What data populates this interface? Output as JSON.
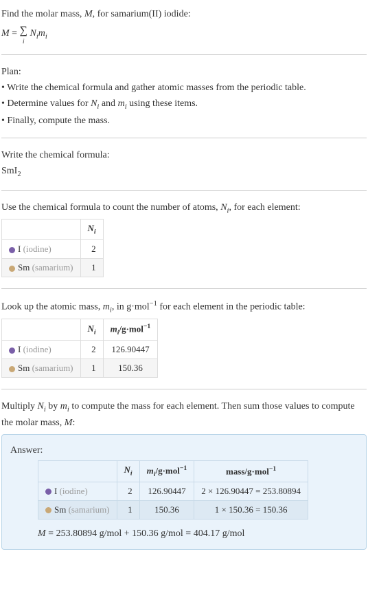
{
  "intro": {
    "line1_prefix": "Find the molar mass, ",
    "line1_var": "M",
    "line1_suffix": ", for samarium(II) iodide:",
    "formula_lhs": "M",
    "formula_eq": " = ",
    "formula_sigma": "∑",
    "formula_sigma_under": "i",
    "formula_rhs_N": "N",
    "formula_rhs_Nsub": "i",
    "formula_rhs_m": "m",
    "formula_rhs_msub": "i"
  },
  "plan": {
    "heading": "Plan:",
    "item1": "• Write the chemical formula and gather atomic masses from the periodic table.",
    "item2_prefix": "• Determine values for ",
    "item2_N": "N",
    "item2_Nsub": "i",
    "item2_mid": " and ",
    "item2_m": "m",
    "item2_msub": "i",
    "item2_suffix": " using these items.",
    "item3": "• Finally, compute the mass."
  },
  "step1": {
    "heading": "Write the chemical formula:",
    "formula_base": "SmI",
    "formula_sub": "2"
  },
  "step2": {
    "heading_prefix": "Use the chemical formula to count the number of atoms, ",
    "heading_N": "N",
    "heading_Nsub": "i",
    "heading_suffix": ", for each element:",
    "col_N": "N",
    "col_Nsub": "i",
    "row1_sym": "I",
    "row1_name": " (iodine)",
    "row1_N": "2",
    "row2_sym": "Sm",
    "row2_name": " (samarium)",
    "row2_N": "1"
  },
  "step3": {
    "heading_prefix": "Look up the atomic mass, ",
    "heading_m": "m",
    "heading_msub": "i",
    "heading_mid": ", in g·mol",
    "heading_sup": "−1",
    "heading_suffix": " for each element in the periodic table:",
    "col_N": "N",
    "col_Nsub": "i",
    "col_m": "m",
    "col_msub": "i",
    "col_m_unit": "/g·mol",
    "col_m_sup": "−1",
    "row1_sym": "I",
    "row1_name": " (iodine)",
    "row1_N": "2",
    "row1_m": "126.90447",
    "row2_sym": "Sm",
    "row2_name": " (samarium)",
    "row2_N": "1",
    "row2_m": "150.36"
  },
  "step4": {
    "heading_prefix": "Multiply ",
    "heading_N": "N",
    "heading_Nsub": "i",
    "heading_mid": " by ",
    "heading_m": "m",
    "heading_msub": "i",
    "heading_mid2": " to compute the mass for each element. Then sum those values to compute the molar mass, ",
    "heading_M": "M",
    "heading_suffix": ":"
  },
  "answer": {
    "label": "Answer:",
    "col_N": "N",
    "col_Nsub": "i",
    "col_m": "m",
    "col_msub": "i",
    "col_m_unit": "/g·mol",
    "col_m_sup": "−1",
    "col_mass": "mass/g·mol",
    "col_mass_sup": "−1",
    "row1_sym": "I",
    "row1_name": " (iodine)",
    "row1_N": "2",
    "row1_m": "126.90447",
    "row1_mass": "2 × 126.90447 = 253.80894",
    "row2_sym": "Sm",
    "row2_name": " (samarium)",
    "row2_N": "1",
    "row2_m": "150.36",
    "row2_mass": "1 × 150.36 = 150.36",
    "final_M": "M",
    "final_eq": " = 253.80894 g/mol + 150.36 g/mol = 404.17 g/mol"
  }
}
